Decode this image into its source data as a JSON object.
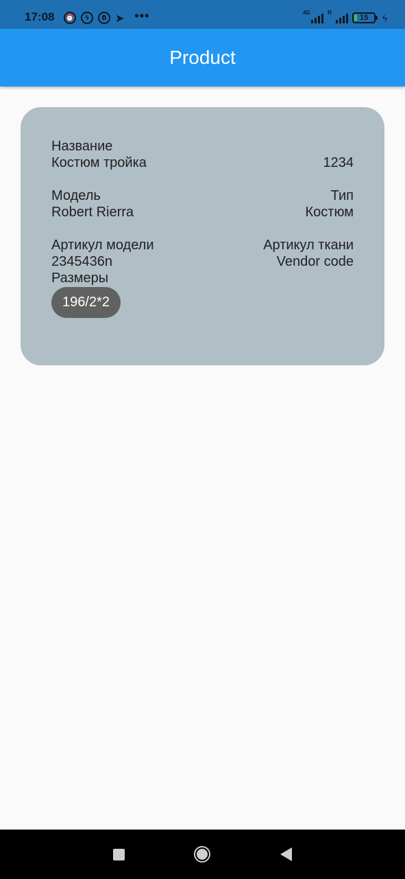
{
  "status_bar": {
    "time": "17:08",
    "overflow": "•••",
    "network_1": "4G",
    "network_2": "R",
    "battery": "15",
    "battery_level": 0.15,
    "icons_left": [
      "alarm-icon",
      "messenger-icon",
      "vk-icon",
      "telegram-icon"
    ],
    "icons_right": [
      "signal-icon",
      "signal-icon",
      "battery-icon",
      "charging-icon"
    ]
  },
  "app_bar": {
    "title": "Product",
    "color": "#2196f3"
  },
  "card": {
    "background": "#b0bec5",
    "name_label": "Название",
    "name_value": "Костюм тройка",
    "id_value": "1234",
    "model_label": "Модель",
    "model_value": "Robert Rierra",
    "type_label": "Тип",
    "type_value": "Костюм",
    "model_article_label": "Артикул модели",
    "model_article_value": "2345436n",
    "fabric_article_label": "Артикул ткани",
    "fabric_article_value": "Vendor code",
    "sizes_label": "Размеры",
    "sizes": [
      "196/2*2"
    ]
  },
  "nav_bar": {
    "buttons": [
      "recents-button",
      "home-button",
      "back-button"
    ]
  }
}
